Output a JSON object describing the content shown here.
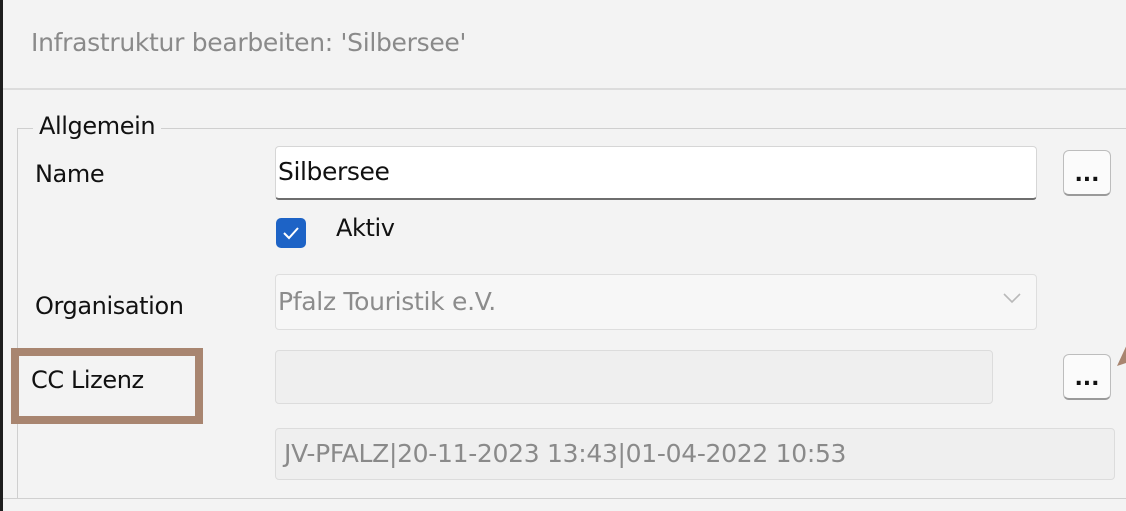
{
  "window": {
    "title": "Infrastruktur bearbeiten: 'Silbersee'"
  },
  "group": {
    "legend": "Allgemein"
  },
  "fields": {
    "name_label": "Name",
    "name_value": "Silbersee",
    "name_button": "...",
    "active_label": "Aktiv",
    "active_checked": true,
    "organisation_label": "Organisation",
    "organisation_value": "Pfalz Touristik e.V.",
    "cc_label": "CC Lizenz",
    "cc_value": "",
    "cc_button": "...",
    "meta_value": "JV-PFALZ|20-11-2023 13:43|01-04-2022 10:53"
  },
  "icons": {
    "check": "check-icon",
    "dropdown": "chevron-down-icon",
    "annotation": "arrow-icon"
  },
  "colors": {
    "checkbox_accent": "#1d63c6",
    "highlight_border": "#a88570"
  }
}
